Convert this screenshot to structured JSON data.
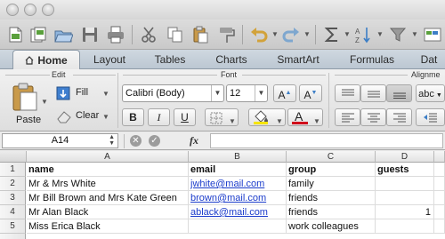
{
  "ribbon_tabs": [
    "Home",
    "Layout",
    "Tables",
    "Charts",
    "SmartArt",
    "Formulas",
    "Dat"
  ],
  "groups": {
    "edit": "Edit",
    "font": "Font",
    "alignment": "Alignme"
  },
  "edit": {
    "paste": "Paste",
    "fill": "Fill",
    "clear": "Clear"
  },
  "font": {
    "name": "Calibri (Body)",
    "size": "12",
    "grow": "A",
    "shrink": "A",
    "bold": "B",
    "italic": "I",
    "underline": "U",
    "color_btn": "A"
  },
  "alignment": {
    "wrap": "abc"
  },
  "formula_bar": {
    "cell_ref": "A14",
    "fx": "fx",
    "value": ""
  },
  "sheet": {
    "columns": [
      "A",
      "B",
      "C",
      "D"
    ],
    "rows": [
      "1",
      "2",
      "3",
      "4",
      "5"
    ],
    "cells": [
      [
        "name",
        "email",
        "group",
        "guests"
      ],
      [
        "Mr & Mrs White",
        "jwhite@mail.com",
        "family",
        ""
      ],
      [
        "Mr Bill Brown and Mrs Kate Green",
        "brown@mail.com",
        "friends",
        ""
      ],
      [
        "Mr Alan Black",
        "ablack@mail.com",
        "friends",
        "1"
      ],
      [
        "Miss Erica Black",
        "",
        "work colleagues",
        ""
      ]
    ]
  },
  "colors": {
    "link": "#1b3ccb",
    "fill_accent": "#f5e400",
    "font_color_accent": "#d0021b",
    "ribbon_tab_bg": "#c4ced8"
  }
}
